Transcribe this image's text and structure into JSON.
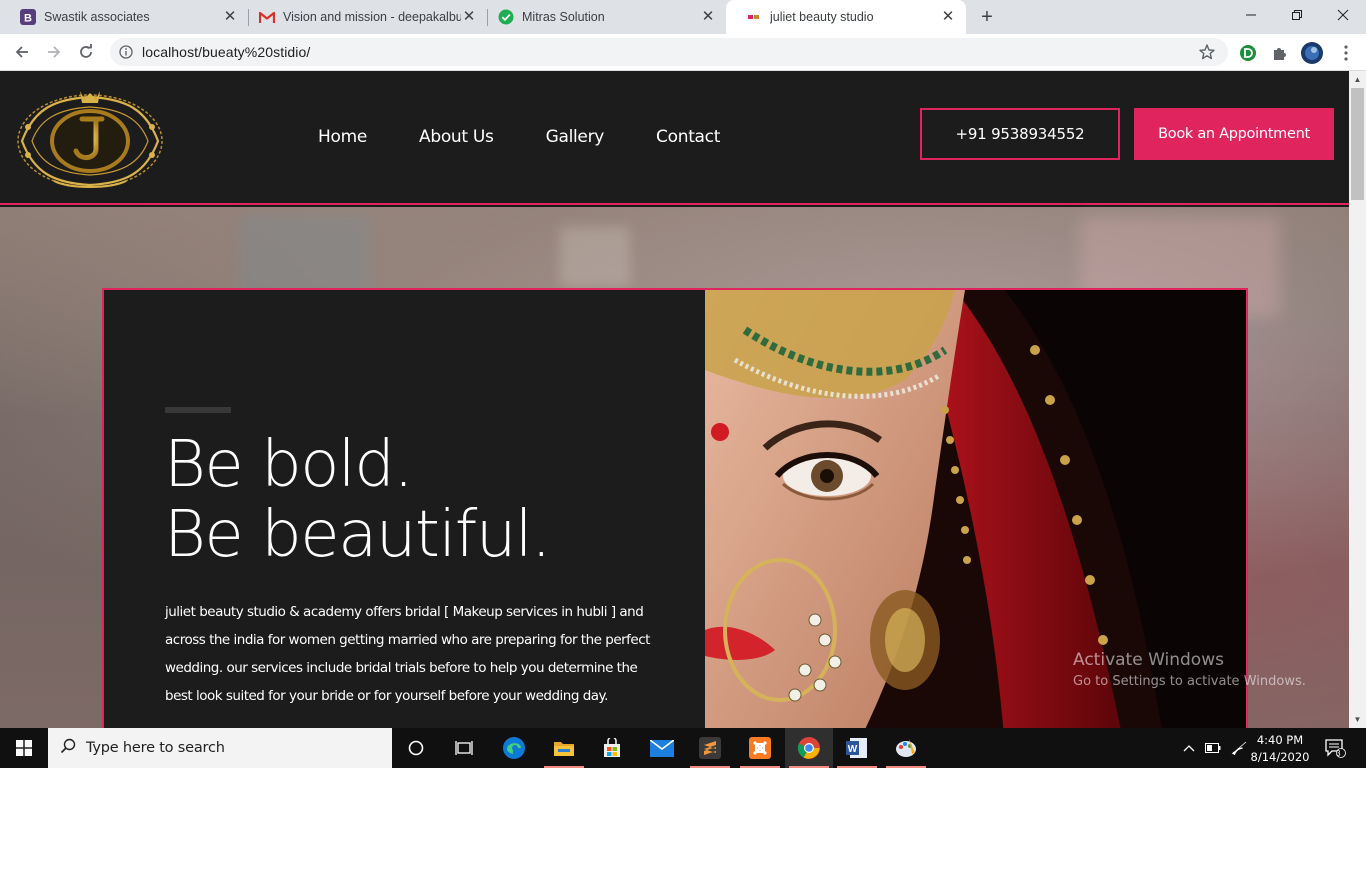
{
  "browser": {
    "tabs": [
      {
        "title": "Swastik associates",
        "icon": "bootstrap-icon",
        "active": false
      },
      {
        "title": "Vision and mission - deepakalbur",
        "icon": "gmail-icon",
        "active": false
      },
      {
        "title": "Mitras Solution",
        "icon": "check-circle-icon",
        "active": false
      },
      {
        "title": "juliet beauty studio",
        "icon": "site-favicon",
        "active": true
      }
    ],
    "address": "localhost/bueaty%20stidio/"
  },
  "site": {
    "nav": [
      "Home",
      "About Us",
      "Gallery",
      "Contact"
    ],
    "phone": "+91 9538934552",
    "cta": "Book an Appointment",
    "hero": {
      "title_line1": "Be bold.",
      "title_line2": "Be beautiful.",
      "text": "juliet beauty studio & academy offers bridal [ Makeup services in hubli ] and across the india for women getting married who are preparing for the perfect wedding. our services include bridal trials before to help you determine the best look suited for your bride or for yourself before your wedding day."
    },
    "accent_color": "#e0245e"
  },
  "watermark": {
    "line1": "Activate Windows",
    "line2": "Go to Settings to activate Windows."
  },
  "taskbar": {
    "search_placeholder": "Type here to search",
    "time": "4:40 PM",
    "date": "8/14/2020",
    "notification_count": "3"
  }
}
